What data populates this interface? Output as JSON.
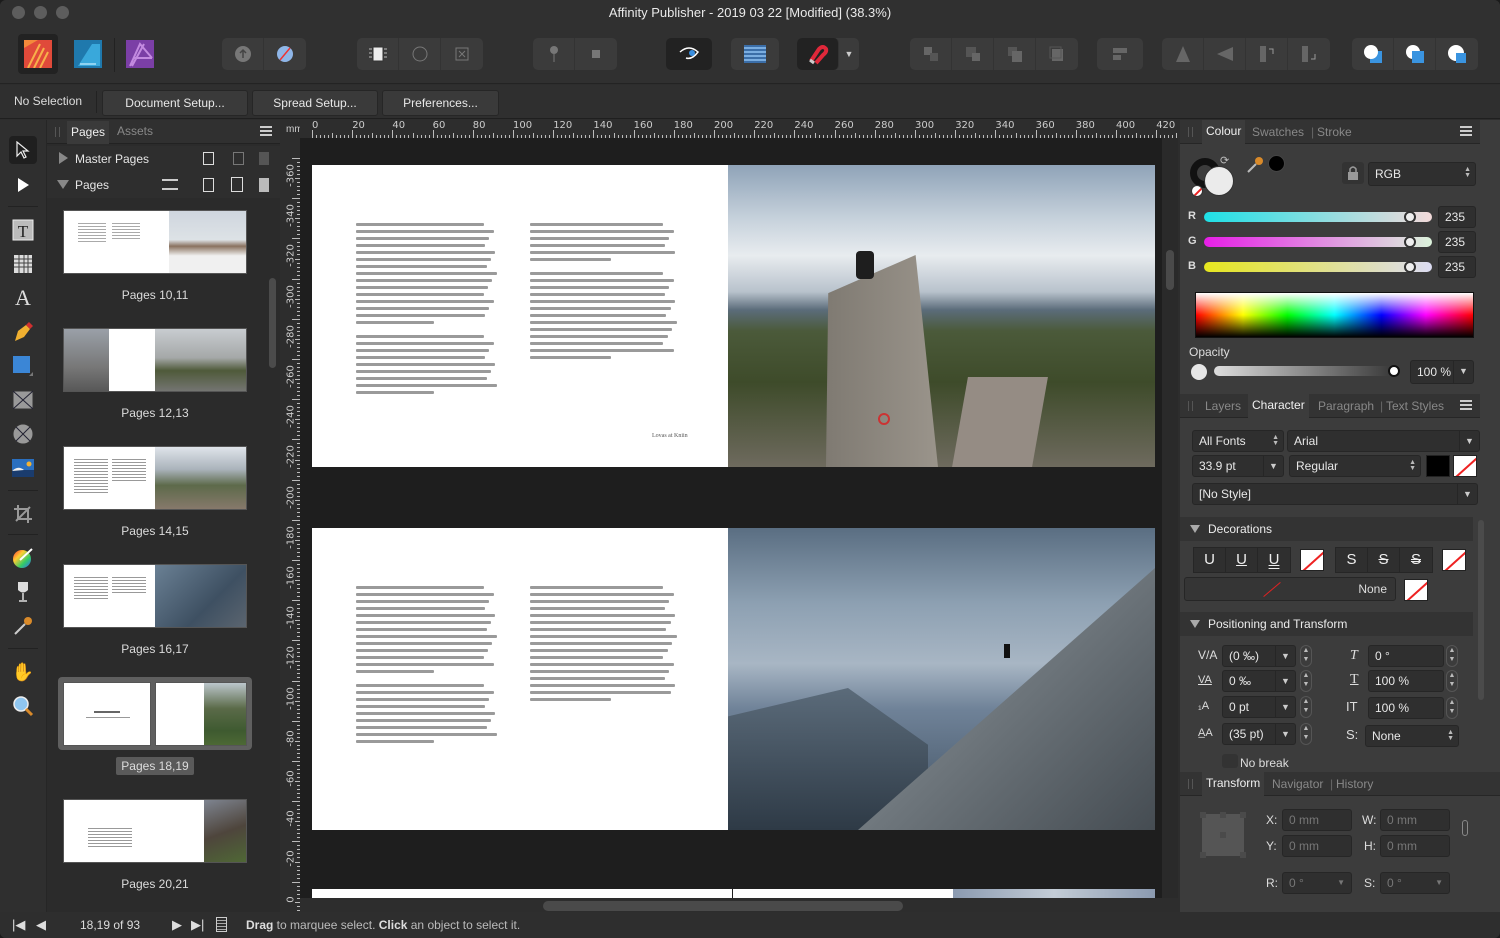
{
  "window": {
    "title": "Affinity Publisher - 2019 03 22 [Modified] (38.3%)"
  },
  "personas": [
    {
      "name": "publisher-persona",
      "color": "#f4793b"
    },
    {
      "name": "designer-persona",
      "color": "#2f8fc4"
    },
    {
      "name": "photo-persona",
      "color": "#9a52c0"
    }
  ],
  "context_bar": {
    "selection_label": "No Selection",
    "buttons": [
      "Document Setup...",
      "Spread Setup...",
      "Preferences..."
    ]
  },
  "pages_panel": {
    "tabs": [
      "Pages",
      "Assets"
    ],
    "active_tab": "Pages",
    "sections": [
      "Master Pages",
      "Pages"
    ],
    "spreads": [
      {
        "label": "Pages 10,11",
        "selected": false
      },
      {
        "label": "Pages 12,13",
        "selected": false
      },
      {
        "label": "Pages 14,15",
        "selected": false
      },
      {
        "label": "Pages 16,17",
        "selected": false
      },
      {
        "label": "Pages 18,19",
        "selected": true
      },
      {
        "label": "Pages 20,21",
        "selected": false
      }
    ]
  },
  "rulers": {
    "unit": "mm",
    "horizontal": [
      "0",
      "20",
      "40",
      "60",
      "80",
      "100",
      "120",
      "140",
      "160",
      "180",
      "200",
      "220",
      "240",
      "260",
      "280",
      "300",
      "320",
      "340",
      "360",
      "380",
      "400",
      "420"
    ],
    "vertical": [
      "-360",
      "-340",
      "-320",
      "-300",
      "-280",
      "-260",
      "-240",
      "-220",
      "-200",
      "-180",
      "-160",
      "-140",
      "-120",
      "-100",
      "-80",
      "-60",
      "-40",
      "-20",
      "0"
    ]
  },
  "canvas": {
    "spread1_footer": "Lovas at Kniin"
  },
  "status_bar": {
    "page_indicator": "18,19 of 93",
    "hint_bold1": "Drag",
    "hint_text1": " to marquee select. ",
    "hint_bold2": "Click",
    "hint_text2": " an object to select it."
  },
  "colour_panel": {
    "tabs": [
      "Colour",
      "Swatches",
      "Stroke"
    ],
    "active_tab": "Colour",
    "model": "RGB",
    "channels": [
      {
        "label": "R",
        "value": "235",
        "fraction": 0.92
      },
      {
        "label": "G",
        "value": "235",
        "fraction": 0.92
      },
      {
        "label": "B",
        "value": "235",
        "fraction": 0.92
      }
    ],
    "opacity_label": "Opacity",
    "opacity_value": "100 %"
  },
  "character_panel": {
    "tabs": [
      "Layers",
      "Character",
      "Paragraph",
      "Text Styles"
    ],
    "active_tab": "Character",
    "font_collection": "All Fonts",
    "font_family": "Arial",
    "font_size": "33.9 pt",
    "font_style": "Regular",
    "char_style": "[No Style]",
    "decorations_title": "Decorations",
    "decoration_line": "None",
    "positioning_title": "Positioning and Transform",
    "positioning": {
      "tracking": "(0 ‰)",
      "kerning": "0 ‰",
      "baseline": "0 pt",
      "leading": "(35 pt)",
      "shear": "0 °",
      "horiz_scale": "100 %",
      "vert_scale": "100 %",
      "typographic_position": "None"
    },
    "no_break_label": "No break"
  },
  "transform_panel": {
    "tabs": [
      "Transform",
      "Navigator",
      "History"
    ],
    "active_tab": "Transform",
    "x_label": "X:",
    "x_value": "0 mm",
    "y_label": "Y:",
    "y_value": "0 mm",
    "w_label": "W:",
    "w_value": "0 mm",
    "h_label": "H:",
    "h_value": "0 mm",
    "r_label": "R:",
    "r_value": "0 °",
    "s_label": "S:",
    "s_value": "0 °"
  }
}
